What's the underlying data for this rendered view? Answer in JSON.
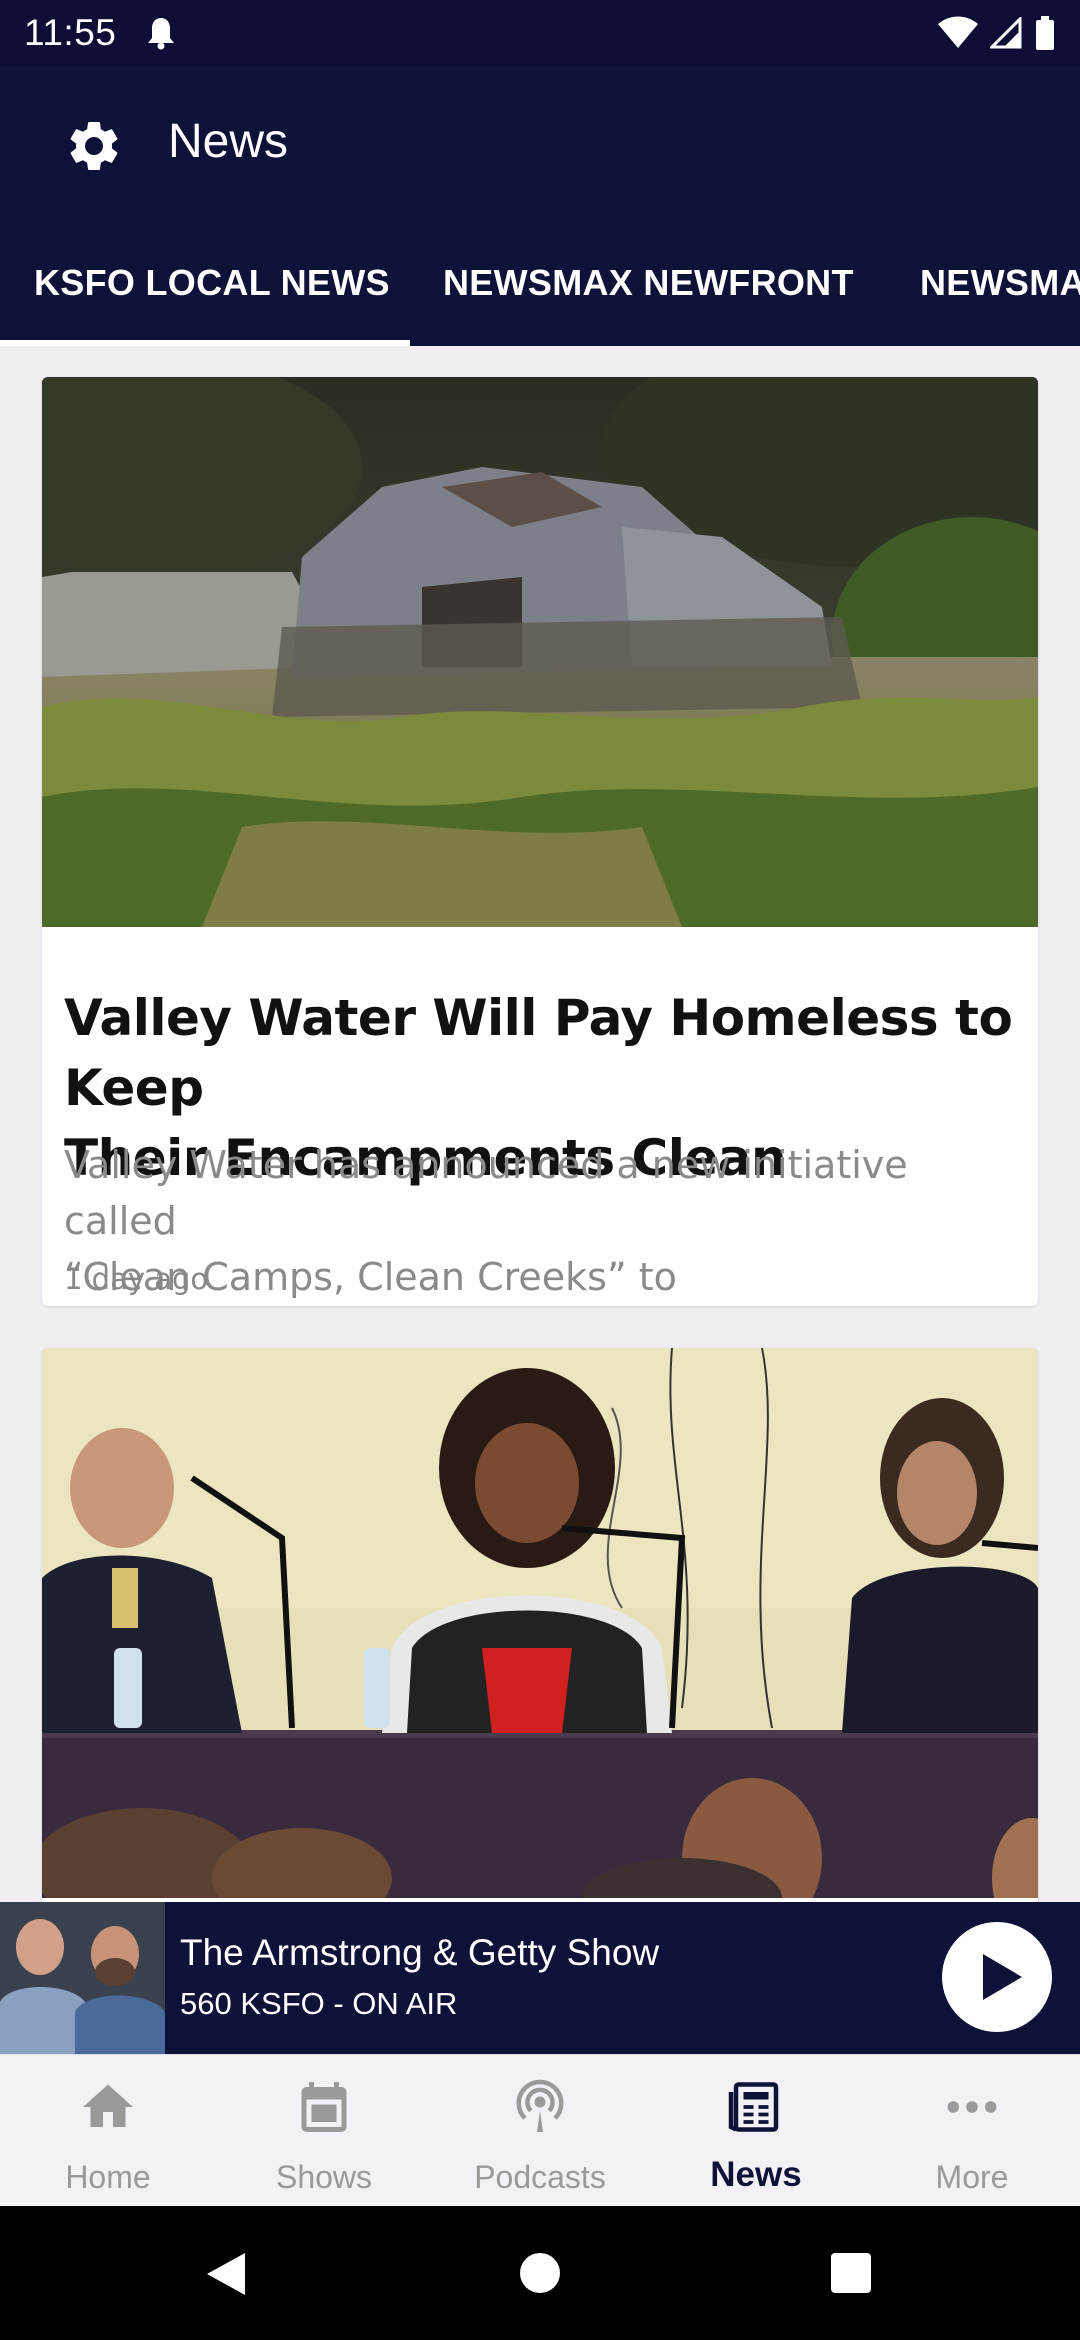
{
  "status_bar": {
    "time": "11:55"
  },
  "header": {
    "title": "News",
    "settings_icon": "gear-icon"
  },
  "tabs": [
    {
      "label": "KSFO LOCAL NEWS",
      "active": true
    },
    {
      "label": "NEWSMAX NEWFRONT",
      "active": false
    },
    {
      "label": "NEWSMAX",
      "active": false
    }
  ],
  "articles": [
    {
      "title_line1": "Valley Water Will Pay Homeless to Keep",
      "title_line2": "Their Encampments Clean",
      "desc_line1": "Valley Water has announced a new initiative called",
      "desc_line2": "“Clean Camps, Clean Creeks” to",
      "time": "1 day ago"
    }
  ],
  "player": {
    "title": "The Armstrong & Getty Show",
    "subtitle": "560 KSFO - ON AIR"
  },
  "bottom_nav": [
    {
      "label": "Home",
      "icon": "home-icon"
    },
    {
      "label": "Shows",
      "icon": "calendar-icon"
    },
    {
      "label": "Podcasts",
      "icon": "podcast-icon"
    },
    {
      "label": "News",
      "icon": "newspaper-icon",
      "active": true
    },
    {
      "label": "More",
      "icon": "more-icon"
    }
  ],
  "colors": {
    "brand_navy": "#0f1238",
    "inactive_nav": "#9a9a9a"
  }
}
